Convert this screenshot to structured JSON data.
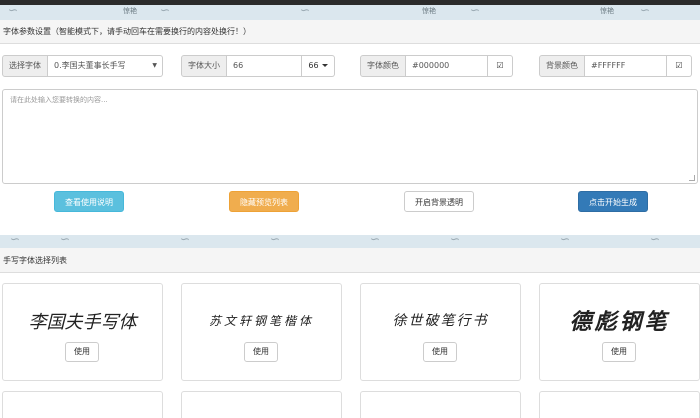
{
  "settings": {
    "title": "字体参数设置（智能模式下，请手动回车在需要换行的内容处换行！）",
    "font": {
      "label": "选择字体",
      "value": "0.李国夫董事长手写"
    },
    "size": {
      "label": "字体大小",
      "value": "66",
      "select": "66"
    },
    "font_color": {
      "label": "字体颜色",
      "value": "#000000",
      "color": "#000000"
    },
    "bg_color": {
      "label": "背景颜色",
      "value": "#FFFFFF",
      "color": "#FFFFFF"
    },
    "text_placeholder": "请在此处输入您要转换的内容...",
    "buttons": {
      "instructions": "查看使用说明",
      "hide_preview": "隐藏预览列表",
      "transparent_bg": "开启背景透明",
      "generate": "点击开始生成"
    },
    "banner_stamp": "惊艳"
  },
  "font_list": {
    "title": "手写字体选择列表",
    "use_label": "使用",
    "cards": [
      {
        "sample": "李国夫手写体"
      },
      {
        "sample": "苏文轩钢笔楷体"
      },
      {
        "sample": "徐世破笔行书"
      },
      {
        "sample": "德彪钢笔"
      },
      {
        "sample": ""
      },
      {
        "sample": ""
      },
      {
        "sample": ""
      },
      {
        "sample": ""
      }
    ]
  },
  "colors": {
    "info": "#5bc0de",
    "warning": "#f0ad4e",
    "primary": "#337ab7",
    "banner": "#dbe7ee"
  }
}
